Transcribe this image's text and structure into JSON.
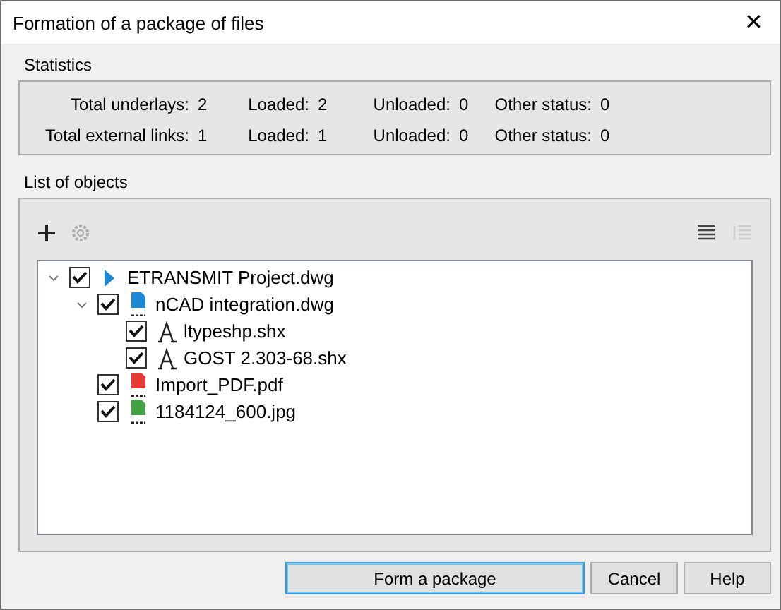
{
  "window": {
    "title": "Formation of a package of files",
    "close": "✕"
  },
  "statistics": {
    "title": "Statistics",
    "rows": [
      [
        {
          "label": "Total underlays:",
          "value": "2"
        },
        {
          "label": "Loaded:",
          "value": "2"
        },
        {
          "label": "Unloaded:",
          "value": "0"
        },
        {
          "label": "Other status:",
          "value": "0"
        }
      ],
      [
        {
          "label": "Total external links:",
          "value": "1"
        },
        {
          "label": "Loaded:",
          "value": "1"
        },
        {
          "label": "Unloaded:",
          "value": "0"
        },
        {
          "label": "Other status:",
          "value": "0"
        }
      ]
    ]
  },
  "objects": {
    "title": "List of objects",
    "toolbar": {
      "list_view_selected": true
    },
    "tree": [
      {
        "name": "ETRANSMIT Project.dwg",
        "kind": "root",
        "checked": true,
        "expanded": true,
        "children": [
          {
            "name": "nCAD integration.dwg",
            "kind": "dwg",
            "checked": true,
            "expanded": true,
            "children": [
              {
                "name": "ltypeshp.shx",
                "kind": "font",
                "checked": true
              },
              {
                "name": "GOST 2.303-68.shx",
                "kind": "font",
                "checked": true
              }
            ]
          },
          {
            "name": "Import_PDF.pdf",
            "kind": "pdf",
            "checked": true
          },
          {
            "name": "1184124_600.jpg",
            "kind": "img",
            "checked": true
          }
        ]
      }
    ]
  },
  "buttons": [
    {
      "label": "Form a package",
      "primary": true
    },
    {
      "label": "Cancel",
      "primary": false
    },
    {
      "label": "Help",
      "primary": false
    }
  ]
}
